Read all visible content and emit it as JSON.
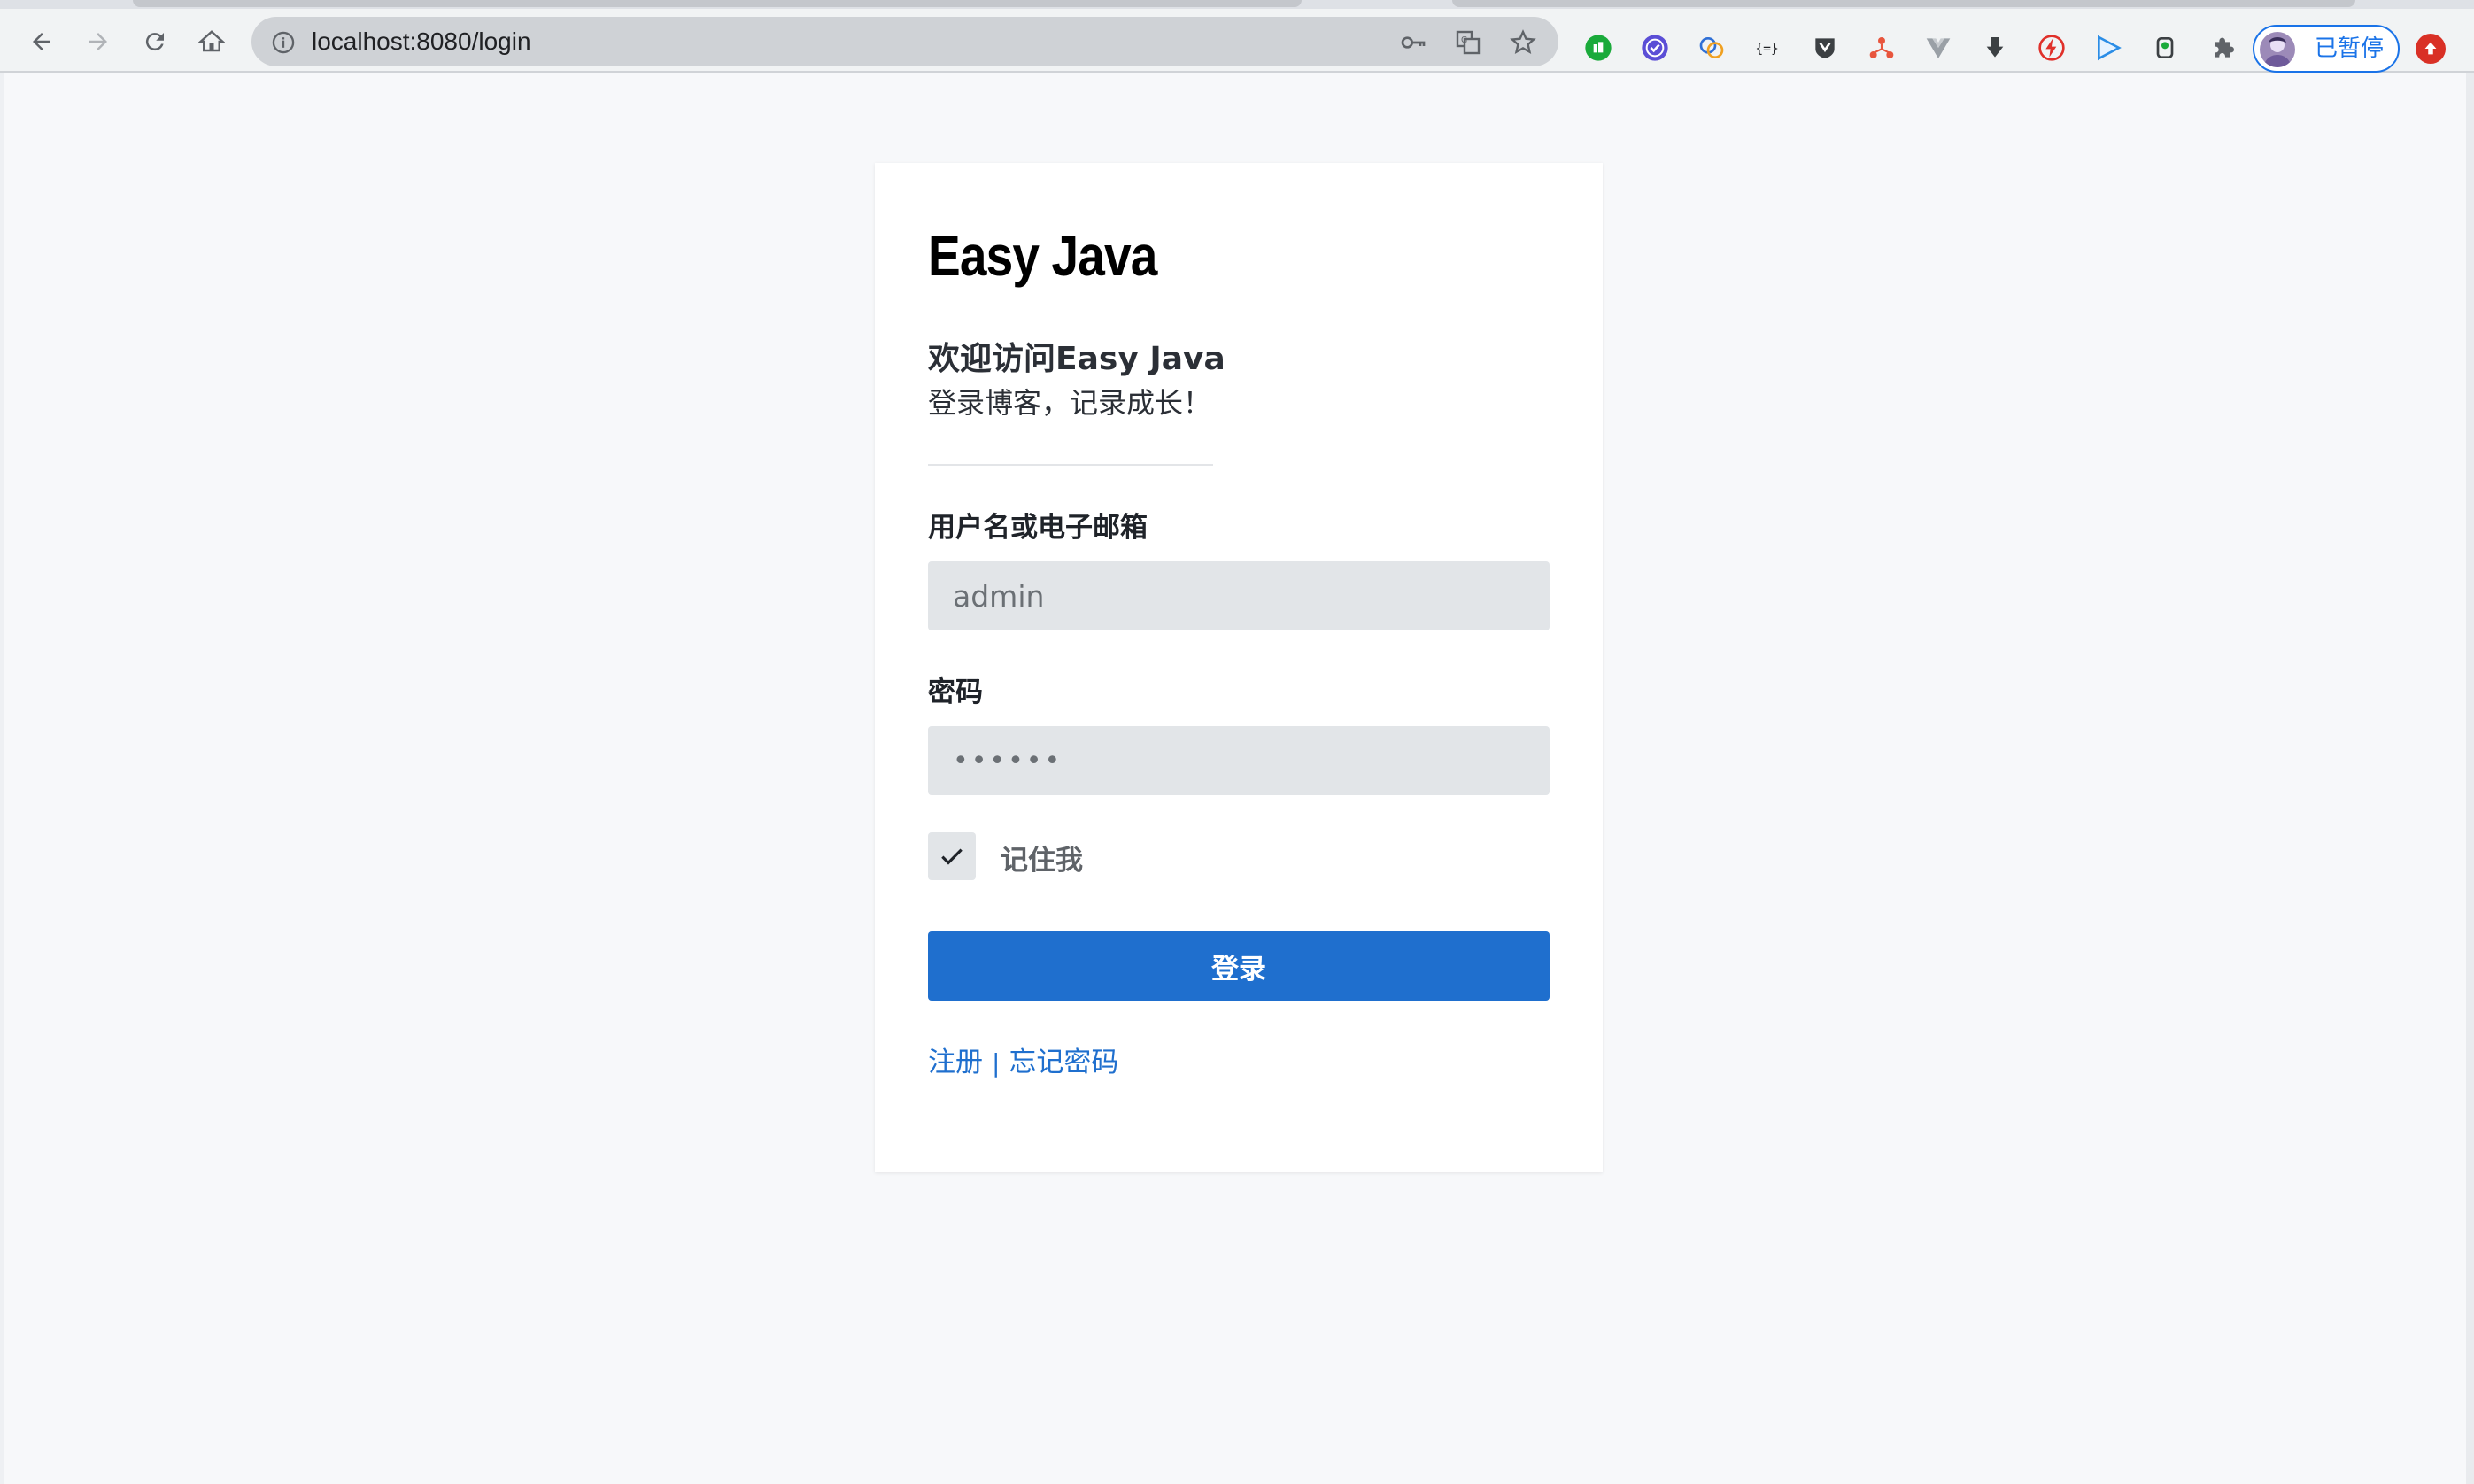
{
  "browser": {
    "url": "localhost:8080/login",
    "profile_label": "已暂停",
    "accent_color": "#1a73e8",
    "nav_icons": [
      "back-icon",
      "forward-icon",
      "reload-icon",
      "home-icon"
    ],
    "omnibox_icons": [
      "key-icon",
      "translate-icon",
      "star-icon"
    ],
    "extension_icons": [
      "green-ext-icon",
      "purple-check-ext-icon",
      "blue-ext-icon",
      "json-ext-icon",
      "shield-ext-icon",
      "network-ext-icon",
      "vue-ext-icon",
      "download-ext-icon",
      "red-bolt-ext-icon",
      "play-ext-icon",
      "leaf-ext-icon",
      "puzzle-icon"
    ]
  },
  "login": {
    "brand": "Easy Java",
    "welcome": "欢迎访问Easy Java",
    "subtitle": "登录博客，记录成长！",
    "username_label": "用户名或电子邮箱",
    "username_value": "admin",
    "password_label": "密码",
    "password_value": "••••••",
    "remember_label": "记住我",
    "remember_checked": true,
    "submit_label": "登录",
    "register_link": "注册",
    "separator": "|",
    "forgot_link": "忘记密码",
    "primary_color": "#1f6fce"
  }
}
